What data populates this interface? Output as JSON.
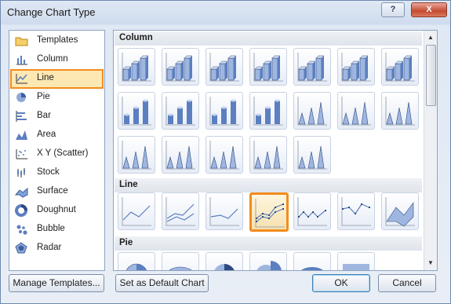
{
  "window": {
    "title": "Change Chart Type",
    "help_glyph": "?",
    "close_glyph": "X"
  },
  "categories": [
    {
      "label": "Templates",
      "icon": "folder-icon"
    },
    {
      "label": "Column",
      "icon": "column-chart-icon"
    },
    {
      "label": "Line",
      "icon": "line-chart-icon",
      "selected": true
    },
    {
      "label": "Pie",
      "icon": "pie-chart-icon"
    },
    {
      "label": "Bar",
      "icon": "bar-chart-icon"
    },
    {
      "label": "Area",
      "icon": "area-chart-icon"
    },
    {
      "label": "X Y (Scatter)",
      "icon": "scatter-chart-icon"
    },
    {
      "label": "Stock",
      "icon": "stock-chart-icon"
    },
    {
      "label": "Surface",
      "icon": "surface-chart-icon"
    },
    {
      "label": "Doughnut",
      "icon": "doughnut-chart-icon"
    },
    {
      "label": "Bubble",
      "icon": "bubble-chart-icon"
    },
    {
      "label": "Radar",
      "icon": "radar-chart-icon"
    }
  ],
  "sections": {
    "column": {
      "title": "Column"
    },
    "line": {
      "title": "Line"
    },
    "pie": {
      "title": "Pie"
    }
  },
  "buttons": {
    "manage_templates": "Manage Templates...",
    "set_default": "Set as Default Chart",
    "ok": "OK",
    "cancel": "Cancel"
  },
  "colors": {
    "accent": "#f28c1e",
    "selection_fill": "#fde8b3",
    "chart_blue": "#5b7fc0"
  }
}
